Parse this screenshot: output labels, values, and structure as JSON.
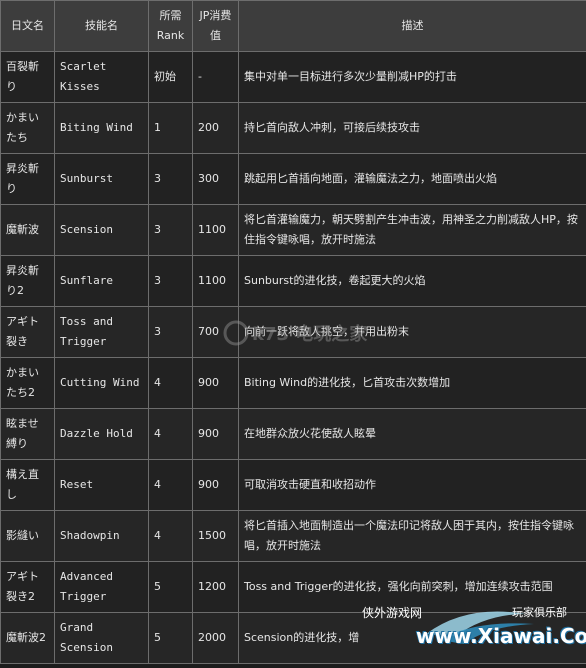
{
  "headers": {
    "jp_name": "日文名",
    "skill_name": "技能名",
    "rank": "所需Rank",
    "jp_cost": "JP消费值",
    "desc": "描述"
  },
  "rows": [
    {
      "jp": "百裂斬り",
      "en": "Scarlet Kisses",
      "rank": "初始",
      "cost": "-",
      "desc": "集中对单一目标进行多次少量削减HP的打击"
    },
    {
      "jp": "かまいたち",
      "en": "Biting Wind",
      "rank": "1",
      "cost": "200",
      "desc": "持匕首向敌人冲刺，可接后续技攻击"
    },
    {
      "jp": "昇炎斬り",
      "en": "Sunburst",
      "rank": "3",
      "cost": "300",
      "desc": "跳起用匕首插向地面，灌输魔法之力，地面喷出火焰"
    },
    {
      "jp": "魔斬波",
      "en": "Scension",
      "rank": "3",
      "cost": "1100",
      "desc": "将匕首灌输魔力，朝天劈割产生冲击波，用神圣之力削减敌人HP，按住指令键咏唱，放开时施法"
    },
    {
      "jp": "昇炎斬り2",
      "en": "Sunflare",
      "rank": "3",
      "cost": "1100",
      "desc": "Sunburst的进化技，卷起更大的火焰"
    },
    {
      "jp": "アギト裂き",
      "en": "Toss and Trigger",
      "rank": "3",
      "cost": "700",
      "desc": "向前一跃将敌人挑空，并用出粉末"
    },
    {
      "jp": "かまいたち2",
      "en": "Cutting Wind",
      "rank": "4",
      "cost": "900",
      "desc": "Biting Wind的进化技，匕首攻击次数增加"
    },
    {
      "jp": "眩ませ縛り",
      "en": "Dazzle Hold",
      "rank": "4",
      "cost": "900",
      "desc": "在地群众放火花使敌人眩晕"
    },
    {
      "jp": "構え直し",
      "en": "Reset",
      "rank": "4",
      "cost": "900",
      "desc": "可取消攻击硬直和收招动作"
    },
    {
      "jp": "影縫い",
      "en": "Shadowpin",
      "rank": "4",
      "cost": "1500",
      "desc": "将匕首插入地面制造出一个魔法印记将敌人困于其内，按住指令键咏唱，放开时施法"
    },
    {
      "jp": "アギト裂き2",
      "en": "Advanced Trigger",
      "rank": "5",
      "cost": "1200",
      "desc": "Toss and Trigger的进化技，强化向前突刺，增加连续攻击范围"
    },
    {
      "jp": "魔斬波2",
      "en": "Grand Scension",
      "rank": "5",
      "cost": "2000",
      "desc": "Scension的进化技，增"
    }
  ],
  "watermarks": {
    "center": "k73 电玩之家",
    "bottom_left": "侠外游戏网",
    "bottom_site": "www.Xiawai.Com",
    "bottom_right": "玩家俱乐部"
  }
}
